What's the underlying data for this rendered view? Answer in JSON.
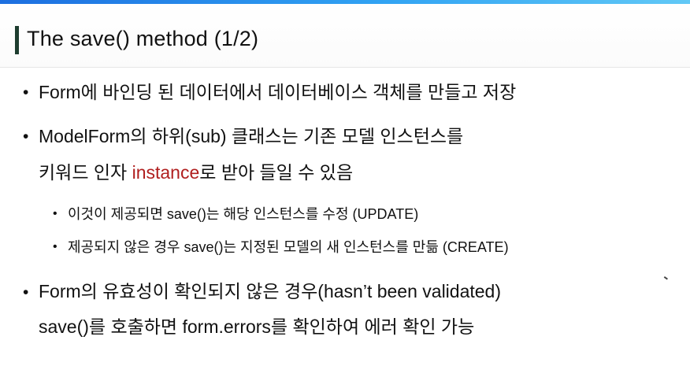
{
  "slide": {
    "title": "The save() method (1/2)"
  },
  "bullets": [
    {
      "text": "Form에 바인딩 된 데이터에서 데이터베이스 객체를 만들고 저장"
    },
    {
      "line1": "ModelForm의 하위(sub) 클래스는 기존 모델 인스턴스를",
      "line2_before": "키워드 인자 ",
      "line2_highlight": "instance",
      "line2_after": "로 받아 들일 수 있음",
      "sub_bullets": [
        "이것이 제공되면 save()는 해당 인스턴스를 수정 (UPDATE)",
        "제공되지 않은 경우 save()는 지정된 모델의 새 인스턴스를 만듦 (CREATE)"
      ]
    },
    {
      "line1": "Form의 유효성이 확인되지 않은 경우(hasn’t been validated)",
      "line2": "save()를 호출하면 form.errors를 확인하여 에러 확인 가능"
    }
  ],
  "bullet_symbol": "•",
  "colors": {
    "accent": "#1e3d2f",
    "highlight": "#b01e1e",
    "top_bar": "#31a3f3"
  }
}
